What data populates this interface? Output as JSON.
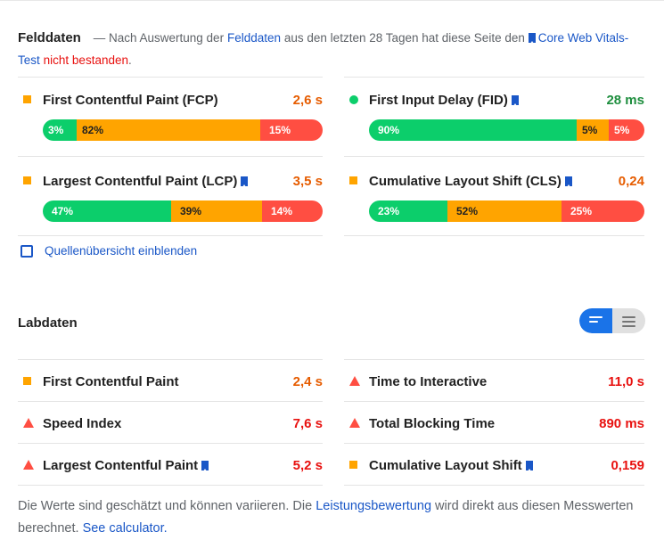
{
  "field_data": {
    "title": "Felddaten",
    "intro_prefix": "— Nach Auswertung der",
    "intro_link": "Felddaten",
    "intro_mid": "aus den letzten 28 Tagen hat diese Seite den",
    "cwv_link": "Core Web Vitals-Test",
    "result": "nicht bestanden",
    "result_suffix": ".",
    "metrics": [
      {
        "name": "First Contentful Paint (FCP)",
        "value": "2,6 s",
        "status": "orange-square",
        "bookmark": false,
        "distribution": {
          "good": "3%",
          "needs_improvement": "82%",
          "poor": "15%"
        }
      },
      {
        "name": "First Input Delay (FID)",
        "value": "28 ms",
        "status": "green-circle",
        "bookmark": true,
        "distribution": {
          "good": "90%",
          "needs_improvement": "5%",
          "poor": "5%"
        }
      },
      {
        "name": "Largest Contentful Paint (LCP)",
        "value": "3,5 s",
        "status": "orange-square",
        "bookmark": true,
        "distribution": {
          "good": "47%",
          "needs_improvement": "39%",
          "poor": "14%"
        }
      },
      {
        "name": "Cumulative Layout Shift (CLS)",
        "value": "0,24",
        "status": "orange-square",
        "bookmark": true,
        "distribution": {
          "good": "23%",
          "needs_improvement": "52%",
          "poor": "25%"
        }
      }
    ],
    "origin_summary_label": "Quellenübersicht einblenden"
  },
  "lab_data": {
    "title": "Labdaten",
    "metrics": [
      {
        "name": "First Contentful Paint",
        "value": "2,4 s",
        "status": "orange-square"
      },
      {
        "name": "Time to Interactive",
        "value": "11,0 s",
        "status": "red-triangle"
      },
      {
        "name": "Speed Index",
        "value": "7,6 s",
        "status": "red-triangle"
      },
      {
        "name": "Total Blocking Time",
        "value": "890 ms",
        "status": "red-triangle"
      },
      {
        "name": "Largest Contentful Paint",
        "value": "5,2 s",
        "status": "red-triangle"
      },
      {
        "name": "Cumulative Layout Shift",
        "value": "0,159",
        "status": "orange-square"
      }
    ]
  },
  "footer": {
    "text_1": "Die Werte sind geschätzt und können variieren. Die",
    "link_1": "Leistungsbewertung",
    "text_2": "wird direkt aus diesen Messwerten berechnet.",
    "link_2": "See calculator."
  },
  "colors": {
    "good": "#0cce6b",
    "average": "#ffa400",
    "poor": "#ff4e42",
    "link": "#1a57c7",
    "toggle_active": "#1a73e8"
  }
}
